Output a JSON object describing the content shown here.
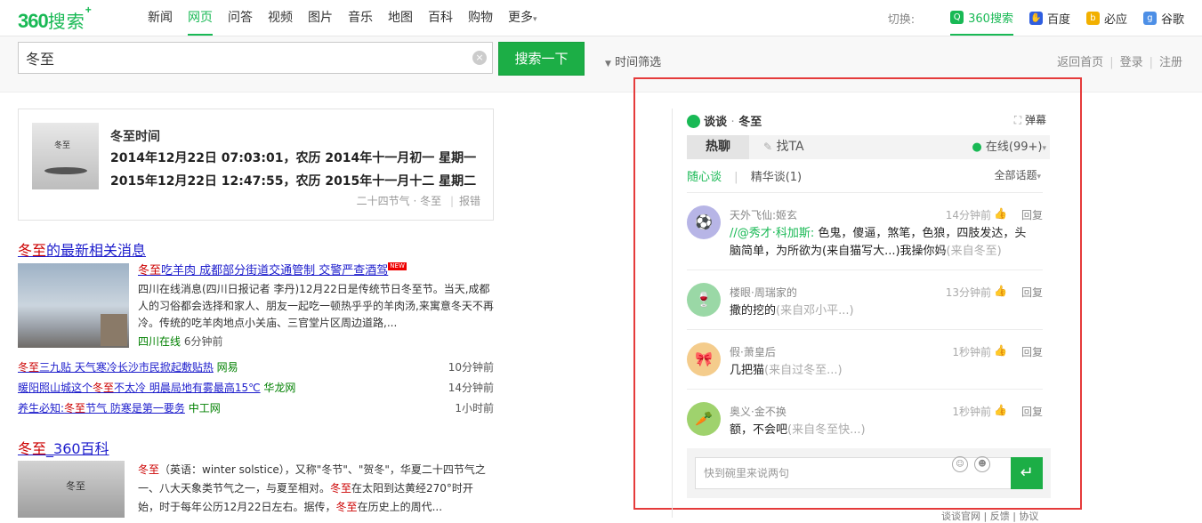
{
  "header": {
    "logo_num": "360",
    "logo_cn": "搜索",
    "logo_plus": "+",
    "nav": [
      "新闻",
      "网页",
      "问答",
      "视频",
      "图片",
      "音乐",
      "地图",
      "百科",
      "购物",
      "更多"
    ],
    "more_arrow": "▾",
    "switch_label": "切换:",
    "engines": [
      "360搜索",
      "百度",
      "必应",
      "谷歌"
    ],
    "colors": {
      "accent": "#19b955"
    }
  },
  "search": {
    "query": "冬至",
    "clear_icon": "×",
    "button": "搜索一下",
    "time_filter": "时间筛选",
    "filter_icon": "▼",
    "links": [
      "返回首页",
      "登录",
      "注册"
    ]
  },
  "card": {
    "thumb_text": "冬至",
    "title": "冬至时间",
    "line1": "2014年12月22日 07:03:01，农历 2014年十一月初一 星期一",
    "line2": "2015年12月22日 12:47:55，农历 2015年十一月十二 星期二",
    "source": "二十四节气 · 冬至",
    "sep": "|",
    "report": "报错"
  },
  "news": {
    "title_kw": "冬至",
    "title_rest": "的最新相关消息",
    "head_kw": "冬至",
    "head_rest": "吃羊肉 成都部分街道交通管制 交警严查酒驾",
    "new_tag": "NEW",
    "summary": "四川在线消息(四川日报记者 李丹)12月22日是传统节日冬至节。当天,成都人的习俗都会选择和家人、朋友一起吃一顿热乎乎的羊肉汤,来寓意冬天不再冷。传统的吃羊肉地点小关庙、三官堂片区周边道路,...",
    "source": "四川在线",
    "time": "6分钟前",
    "items": [
      {
        "pre": "",
        "kw": "冬至",
        "post": "三九贴 天气寒冷长沙市民掀起敷贴热",
        "src": "网易",
        "time": "10分钟前"
      },
      {
        "pre": "暖阳照山城这个",
        "kw": "冬至",
        "post": "不太冷 明晨局地有雾最高15℃",
        "src": "华龙网",
        "time": "14分钟前"
      },
      {
        "pre": "养生必知:",
        "kw": "冬至",
        "post": "节气 防寒是第一要务",
        "src": "中工网",
        "time": "1小时前"
      }
    ]
  },
  "baike": {
    "title_kw": "冬至",
    "title_rest": "_360百科",
    "thumb_text": "冬至",
    "text_kw": "冬至",
    "text_1": "（英语：winter solstice），又称\"冬节\"、\"贺冬\"，华夏二十四节气之一、八大天象类节气之一，与夏至相对。",
    "text_kw2": "冬至",
    "text_2": "在太阳到达黄经270°时开始，时于每年公历12月22日左右。据传，",
    "text_kw3": "冬至",
    "text_3": "在历史上的周代..."
  },
  "chat": {
    "title": "谈谈",
    "dot": "·",
    "topic": "冬至",
    "danmu": "弹幕",
    "danmu_icon": "⛶",
    "tab_hot": "热聊",
    "tab_find": "找TA",
    "find_icon": "✎",
    "online": "在线(99+)",
    "online_arrow": "▾",
    "sub1": "随心谈",
    "sub_sep": "|",
    "sub2": "精华谈(1)",
    "all_topics": "全部话题",
    "all_arrow": "▾",
    "like_icon": "👍",
    "reply": "回复",
    "messages": [
      {
        "name": "天外飞仙:姬玄",
        "time": "14分钟前",
        "text_pre": "//@秀才·科加斯: ",
        "text": "色鬼，傻逼，煞笔，色狼，四肢发达，头脑简单，为所欲为(来自猫写大...)我操你妈",
        "from": "(来自冬至)",
        "avatar_color": "#b7b5e6",
        "avatar_glyph": "⚽"
      },
      {
        "name": "楼眼·周瑞家的",
        "time": "13分钟前",
        "text_pre": "",
        "text": "撒的挖的",
        "from": "(来自邓小平...)",
        "avatar_color": "#9ad8a6",
        "avatar_glyph": "🍷"
      },
      {
        "name": "假·萧皇后",
        "time": "1秒钟前",
        "text_pre": "",
        "text": "几把猫",
        "from": "(来自过冬至...)",
        "avatar_color": "#f4cc8c",
        "avatar_glyph": "🎀"
      },
      {
        "name": "奥义·金不换",
        "time": "1秒钟前",
        "text_pre": "",
        "text": "额，不会吧",
        "from": "(来自冬至快...)",
        "avatar_color": "#9fd26d",
        "avatar_glyph": "🥕"
      }
    ],
    "input_placeholder": "快到碗里来说两句",
    "send_icon": "↵",
    "emoji1": "☺",
    "emoji2": "☻",
    "footer": "谈谈官网 | 反馈 | 协议"
  }
}
